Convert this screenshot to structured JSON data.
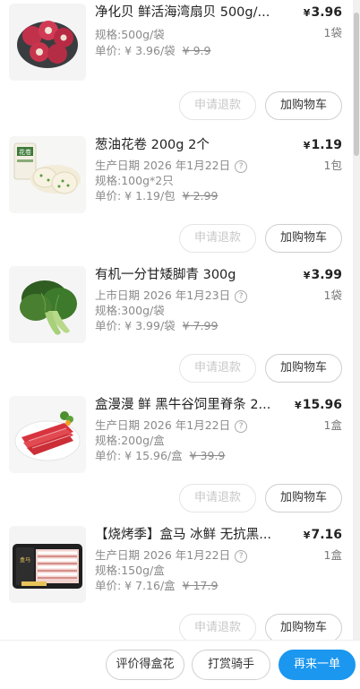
{
  "items": [
    {
      "title": "净化贝 鲜活海湾扇贝 500g/...",
      "price_symbol": "¥",
      "price": "3.96",
      "qty": "1袋",
      "date": "",
      "spec": "规格:500g/袋",
      "unit_price": "单价: ¥ 3.96/袋",
      "orig_price": "¥ 9.9",
      "refund_label": "申请退款",
      "cart_label": "加购物车",
      "image_icon": "scallop-image"
    },
    {
      "title": "葱油花卷 200g 2个",
      "price_symbol": "¥",
      "price": "1.19",
      "qty": "1包",
      "date": "生产日期 2026 年1月22日",
      "spec": "规格:100g*2只",
      "unit_price": "单价: ¥ 1.19/包",
      "orig_price": "¥ 2.99",
      "refund_label": "申请退款",
      "cart_label": "加购物车",
      "image_icon": "flower-roll-image"
    },
    {
      "title": "有机一分甘矮脚青 300g",
      "price_symbol": "¥",
      "price": "3.99",
      "qty": "1袋",
      "date": "上市日期 2026 年1月23日",
      "spec": "规格:300g/袋",
      "unit_price": "单价: ¥ 3.99/袋",
      "orig_price": "¥ 7.99",
      "refund_label": "申请退款",
      "cart_label": "加购物车",
      "image_icon": "bok-choy-image"
    },
    {
      "title": "盒漫漫 鲜 黑牛谷饲里脊条 2...",
      "price_symbol": "¥",
      "price": "15.96",
      "qty": "1盒",
      "date": "生产日期 2026 年1月22日",
      "spec": "规格:200g/盒",
      "unit_price": "单价: ¥ 15.96/盒",
      "orig_price": "¥ 39.9",
      "refund_label": "申请退款",
      "cart_label": "加购物车",
      "image_icon": "beef-strips-image"
    },
    {
      "title": "【烧烤季】盒马 冰鲜 无抗黑...",
      "price_symbol": "¥",
      "price": "7.16",
      "qty": "1盒",
      "date": "生产日期 2026 年1月22日",
      "spec": "规格:150g/盒",
      "unit_price": "单价: ¥ 7.16/盒",
      "orig_price": "¥ 17.9",
      "refund_label": "申请退款",
      "cart_label": "加购物车",
      "image_icon": "pork-belly-image"
    }
  ],
  "bottom_bar": {
    "review_label": "评价得盒花",
    "tip_label": "打赏骑手",
    "reorder_label": "再来一单"
  },
  "colors": {
    "accent": "#1b97f0",
    "price": "#222222",
    "muted": "#8a8a8a"
  }
}
